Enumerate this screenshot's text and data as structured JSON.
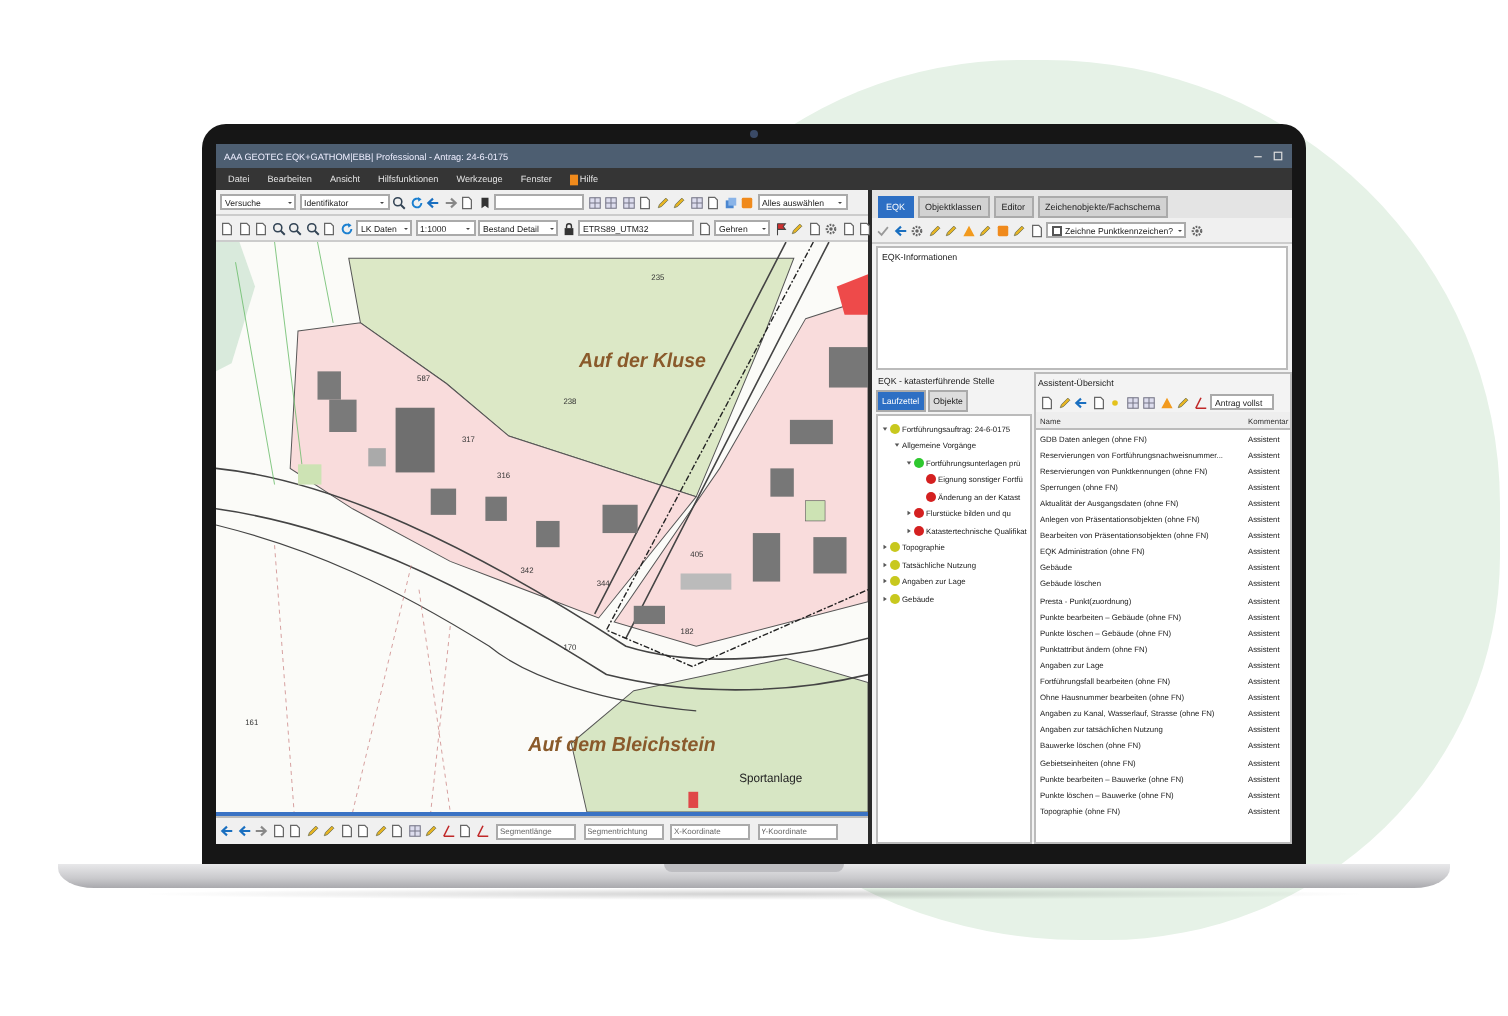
{
  "window": {
    "title": "AAA GEOTEC EQK+GATHOM|EBB| Professional - Antrag: 24-6-0175"
  },
  "menu": [
    {
      "label": "Datei",
      "kind": "text"
    },
    {
      "label": "Bearbeiten",
      "kind": "text"
    },
    {
      "label": "Ansicht",
      "kind": "text"
    },
    {
      "label": "Hilfsfunktionen",
      "kind": "text"
    },
    {
      "label": "Werkzeuge",
      "kind": "text"
    },
    {
      "label": "Fenster",
      "kind": "text"
    },
    {
      "label": "Hilfe",
      "kind": "icon"
    }
  ],
  "toolbar_1": {
    "search_mode": "Versuche",
    "identifier": "Identifikator",
    "select": "Alles auswählen"
  },
  "toolbar_2": {
    "layer": "LK Daten",
    "scale": "1:1000",
    "style": "Bestand Detail",
    "crs": "ETRS89_UTM32",
    "place": "Gehren"
  },
  "map": {
    "labels": [
      {
        "text": "Auf der Kluse",
        "kind": "place"
      },
      {
        "text": "Auf dem Bleichstein",
        "kind": "place"
      },
      {
        "text": "Sportanlage",
        "kind": "area"
      },
      {
        "text": "238",
        "kind": "parcel"
      },
      {
        "text": "235",
        "kind": "parcel"
      },
      {
        "text": "587",
        "kind": "parcel"
      },
      {
        "text": "317",
        "kind": "parcel"
      },
      {
        "text": "316",
        "kind": "parcel"
      },
      {
        "text": "342",
        "kind": "parcel"
      },
      {
        "text": "344",
        "kind": "parcel"
      },
      {
        "text": "170",
        "kind": "parcel"
      },
      {
        "text": "182",
        "kind": "parcel"
      },
      {
        "text": "405",
        "kind": "parcel"
      },
      {
        "text": "161",
        "kind": "parcel"
      }
    ]
  },
  "status_bar": {
    "fields": [
      {
        "placeholder": "Segmentlänge"
      },
      {
        "placeholder": "Segmentrichtung"
      },
      {
        "placeholder": "X-Koordinate"
      },
      {
        "placeholder": "Y-Koordinate"
      }
    ]
  },
  "right_panel": {
    "tabs": [
      {
        "label": "EQK",
        "selected": true
      },
      {
        "label": "Objektklassen",
        "selected": false
      },
      {
        "label": "Editor",
        "selected": false
      },
      {
        "label": "Zeichenobjekte/Fachschema",
        "selected": false
      }
    ],
    "draw_option": "Zeichne Punktkennzeichen?",
    "info_label": "EQK-Informationen",
    "tree_title": "EQK - katasterführende Stelle",
    "tree_tabs": [
      {
        "label": "Laufzettel",
        "selected": true
      },
      {
        "label": "Objekte",
        "selected": false
      }
    ],
    "tree": [
      {
        "label": "Fortführungsauftrag: 24-6-0175",
        "color": "#c8c81e",
        "expanded": true,
        "children": [
          {
            "label": "Allgemeine Vorgänge",
            "expanded": true,
            "children": [
              {
                "label": "Fortführungsunterlagen prü",
                "color": "#2ec82e",
                "expanded": true,
                "children": [
                  {
                    "label": "Eignung sonstiger Fortfü",
                    "color": "#d42020"
                  },
                  {
                    "label": "Änderung an der Katast",
                    "color": "#d42020"
                  }
                ]
              },
              {
                "label": "Flurstücke bilden und qu",
                "color": "#d42020",
                "expanded": false
              },
              {
                "label": "Katastertechnische Qualifikat",
                "color": "#d42020",
                "expanded": false
              }
            ]
          }
        ]
      },
      {
        "label": "Topographie",
        "color": "#c8c81e",
        "expanded": false
      },
      {
        "label": "Tatsächliche Nutzung",
        "color": "#c8c81e",
        "expanded": false
      },
      {
        "label": "Angaben zur Lage",
        "color": "#c8c81e",
        "expanded": false
      },
      {
        "label": "Gebäude",
        "color": "#c8c81e",
        "expanded": false
      }
    ],
    "assistant_title": "Assistent-Übersicht",
    "assistant_filter": "Antrag vollst",
    "columns": [
      "Name",
      "Kommentar"
    ],
    "rows": [
      [
        "GDB Daten anlegen (ohne FN)",
        "Assistent"
      ],
      [
        "Reservierungen von Fortführungsnachweisnummer...",
        "Assistent"
      ],
      [
        "Reservierungen von Punktkennungen (ohne FN)",
        "Assistent"
      ],
      [
        "Sperrungen (ohne FN)",
        "Assistent"
      ],
      [
        "Aktualität der Ausgangsdaten (ohne FN)",
        "Assistent"
      ],
      [
        "Anlegen von Präsentationsobjekten (ohne FN)",
        "Assistent"
      ],
      [
        "Bearbeiten von Präsentationsobjekten (ohne FN)",
        "Assistent"
      ],
      [
        "EQK Administration (ohne FN)",
        "Assistent"
      ],
      [
        "Gebäude",
        "Assistent"
      ],
      [
        "Gebäude löschen",
        "Assistent"
      ],
      [
        "Presta - Punkt(zuordnung)",
        "Assistent"
      ],
      [
        "Punkte bearbeiten – Gebäude (ohne FN)",
        "Assistent"
      ],
      [
        "Punkte löschen – Gebäude (ohne FN)",
        "Assistent"
      ],
      [
        "Punktattribut ändern (ohne FN)",
        "Assistent"
      ],
      [
        "Angaben zur Lage",
        "Assistent"
      ],
      [
        "Fortführungsfall bearbeiten (ohne FN)",
        "Assistent"
      ],
      [
        "Ohne Hausnummer bearbeiten (ohne FN)",
        "Assistent"
      ],
      [
        "Angaben zu Kanal, Wasserlauf, Strasse (ohne FN)",
        "Assistent"
      ],
      [
        "Angaben zur tatsächlichen Nutzung",
        "Assistent"
      ],
      [
        "Bauwerke löschen (ohne FN)",
        "Assistent"
      ],
      [
        "Gebietseinheiten (ohne FN)",
        "Assistent"
      ],
      [
        "Punkte bearbeiten – Bauwerke (ohne FN)",
        "Assistent"
      ],
      [
        "Punkte löschen – Bauwerke (ohne FN)",
        "Assistent"
      ],
      [
        "Topographie (ohne FN)",
        "Assistent"
      ]
    ]
  }
}
